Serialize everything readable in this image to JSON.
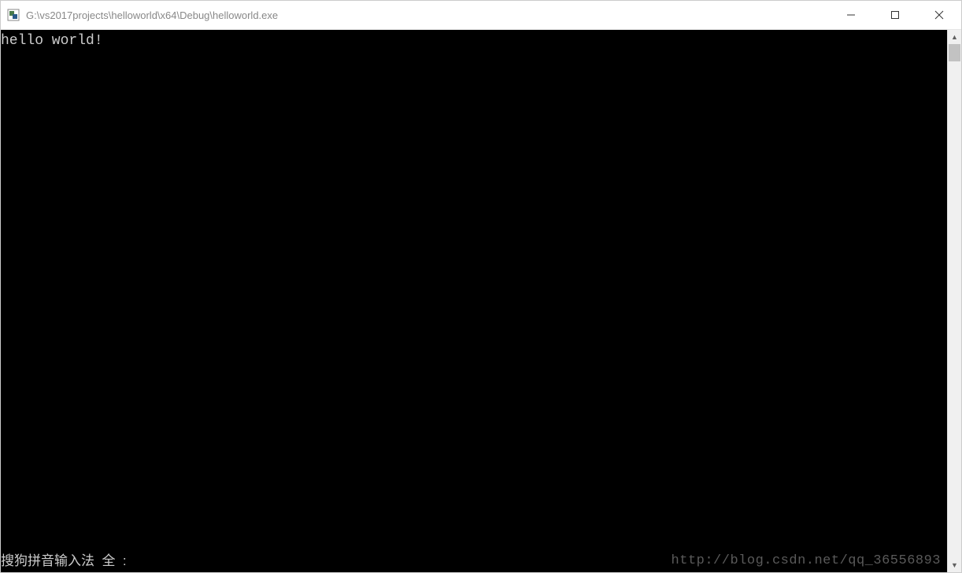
{
  "window": {
    "title": "G:\\vs2017projects\\helloworld\\x64\\Debug\\helloworld.exe"
  },
  "console": {
    "output": "hello world!",
    "ime_status": "搜狗拼音输入法  全  :"
  },
  "watermark": "http://blog.csdn.net/qq_36556893",
  "scroll": {
    "up": "▲",
    "down": "▼"
  }
}
